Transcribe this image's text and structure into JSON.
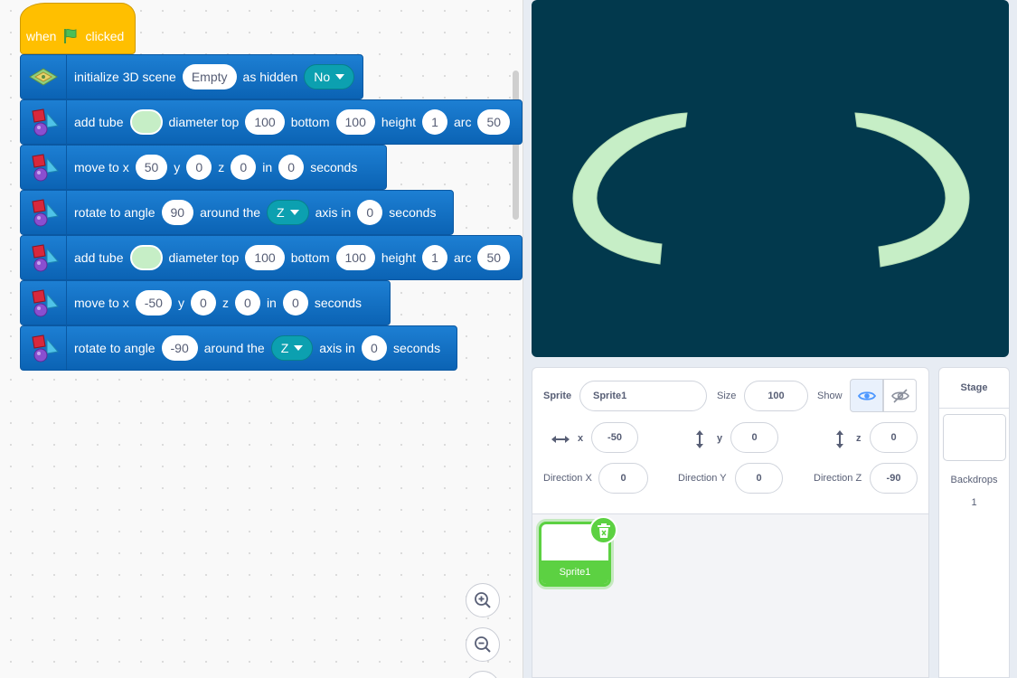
{
  "code": {
    "hat": {
      "when": "when",
      "clicked": "clicked",
      "flag_icon": "green-flag-icon",
      "flag_color": "#4cbf56"
    },
    "blocks": [
      {
        "type": "initialize",
        "label1": "initialize 3D scene",
        "scene": "Empty",
        "label2": "as hidden",
        "hidden": "No"
      },
      {
        "type": "add-tube",
        "label1": "add tube",
        "color": "#c6eec6",
        "label2": "diameter top",
        "top": "100",
        "label3": "bottom",
        "bottom": "100",
        "label4": "height",
        "height": "1",
        "label5": "arc",
        "arc": "50"
      },
      {
        "type": "move",
        "label1": "move to x",
        "x": "50",
        "label2": "y",
        "y": "0",
        "label3": "z",
        "z": "0",
        "label4": "in",
        "secs": "0",
        "label5": "seconds"
      },
      {
        "type": "rotate",
        "label1": "rotate to angle",
        "angle": "90",
        "label2": "around the",
        "axis": "Z",
        "label3": "axis in",
        "secs": "0",
        "label4": "seconds"
      },
      {
        "type": "add-tube",
        "label1": "add tube",
        "color": "#c6eec6",
        "label2": "diameter top",
        "top": "100",
        "label3": "bottom",
        "bottom": "100",
        "label4": "height",
        "height": "1",
        "label5": "arc",
        "arc": "50"
      },
      {
        "type": "move",
        "label1": "move to x",
        "x": "-50",
        "label2": "y",
        "y": "0",
        "label3": "z",
        "z": "0",
        "label4": "in",
        "secs": "0",
        "label5": "seconds"
      },
      {
        "type": "rotate",
        "label1": "rotate to angle",
        "angle": "-90",
        "label2": "around the",
        "axis": "Z",
        "label3": "axis in",
        "secs": "0",
        "label4": "seconds"
      }
    ],
    "block_color": "#0e6ec4",
    "hat_color": "#ffbf00"
  },
  "stage": {
    "background": "#02394d",
    "shape_color": "#c6eec6"
  },
  "sprite_info": {
    "sprite_label": "Sprite",
    "sprite_name": "Sprite1",
    "size_label": "Size",
    "size": "100",
    "show_label": "Show",
    "x_label": "x",
    "x": "-50",
    "y_label": "y",
    "y": "0",
    "z_label": "z",
    "z": "0",
    "dir_x_label": "Direction X",
    "dir_x": "0",
    "dir_y_label": "Direction Y",
    "dir_y": "0",
    "dir_z_label": "Direction Z",
    "dir_z": "-90"
  },
  "sprite_list": {
    "selected_sprite": "Sprite1",
    "accent": "#5cd142"
  },
  "stage_panel": {
    "title": "Stage",
    "backdrops_label": "Backdrops",
    "backdrops_count": "1"
  }
}
